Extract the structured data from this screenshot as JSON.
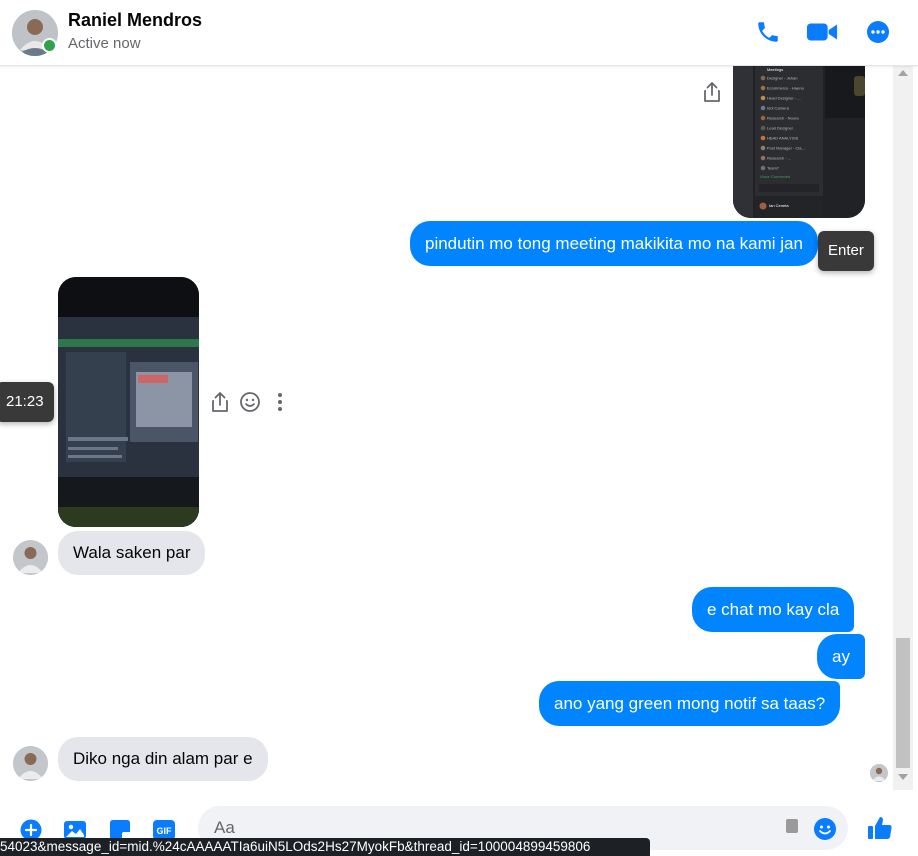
{
  "header": {
    "contact_name": "Raniel Mendros",
    "status": "Active now",
    "icons": [
      "phone-icon",
      "video-camera-icon",
      "more-options-icon"
    ]
  },
  "messages": [
    {
      "from": "me",
      "type": "image",
      "image_preview": {
        "title": "Meetings",
        "rows": [
          "Designer - Jehan",
          "Ecommerce - Haena",
          "Head Designer - ...",
          "Idol Camera",
          "Research - Noura",
          "Lead Designer",
          "HEAD ANALYSIS",
          "Post Manager - Cla...",
          "Research - ...",
          "Team7"
        ],
        "footer": "Voice Connected",
        "user": "Ian Ceneta"
      }
    },
    {
      "from": "me",
      "type": "text",
      "text": "pindutin mo tong meeting makikita mo na kami jan"
    },
    {
      "from": "them",
      "type": "image"
    },
    {
      "from": "them",
      "type": "text",
      "text": "Wala saken par"
    },
    {
      "from": "me",
      "type": "text",
      "text": "e chat mo kay cla"
    },
    {
      "from": "me",
      "type": "text",
      "text": "ay"
    },
    {
      "from": "me",
      "type": "text",
      "text": "ano yang green mong notif sa taas?"
    },
    {
      "from": "them",
      "type": "text",
      "text": "Diko nga din alam par e"
    }
  ],
  "tooltips": {
    "enter": "Enter",
    "time": "21:23"
  },
  "composer": {
    "placeholder": "Aa",
    "icons": [
      "add-icon",
      "photo-icon",
      "sticker-icon",
      "gif-icon",
      "emoji-icon",
      "like-icon"
    ],
    "gif_label": "GIF"
  },
  "status_url": "54023&message_id=mid.%24cAAAAATIa6uiN5LOds2Hs27MyokFb&thread_id=100004899459806",
  "colors": {
    "accent": "#0084ff",
    "incoming_bubble": "#e4e6eb",
    "online": "#31a24c",
    "icon_blue": "#0a7cff"
  }
}
